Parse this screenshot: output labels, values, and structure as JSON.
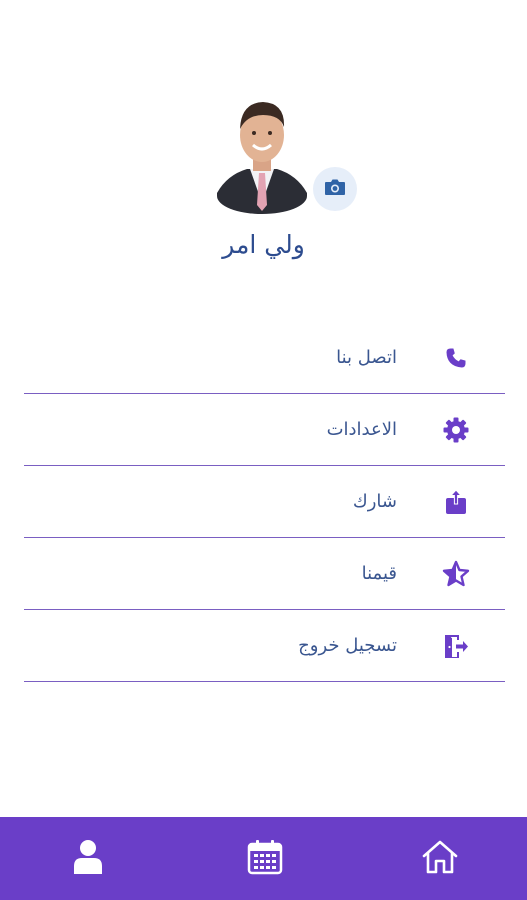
{
  "profile": {
    "name": "ولي امر",
    "camera_icon": "camera-icon"
  },
  "menu": {
    "items": [
      {
        "label": "اتصل بنا",
        "icon": "phone-icon"
      },
      {
        "label": "الاعدادات",
        "icon": "gear-icon"
      },
      {
        "label": "شارك",
        "icon": "share-icon"
      },
      {
        "label": "قيمنا",
        "icon": "star-icon"
      },
      {
        "label": "تسجيل خروج",
        "icon": "logout-icon"
      }
    ]
  },
  "bottom_nav": {
    "items": [
      {
        "icon": "user-icon"
      },
      {
        "icon": "calendar-icon"
      },
      {
        "icon": "home-icon"
      }
    ]
  },
  "colors": {
    "accent": "#6a3ec8",
    "divider": "#7a5ec2",
    "text": "#3a5690",
    "icon": "#6a3ec8"
  }
}
